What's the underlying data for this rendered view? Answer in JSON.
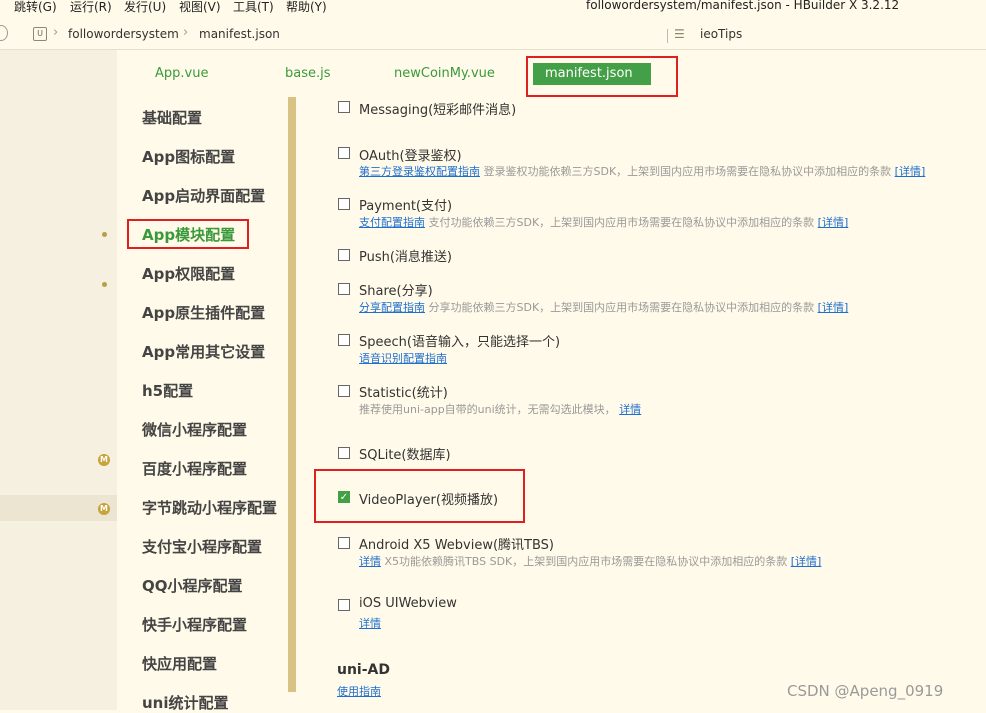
{
  "menubar": {
    "items": [
      "跳转(G)",
      "运行(R)",
      "发行(U)",
      "视图(V)",
      "工具(T)",
      "帮助(Y)"
    ],
    "window_title": "followordersystem/manifest.json - HBuilder X 3.2.12"
  },
  "breadcrumb": {
    "project": "followordersystem",
    "file": "manifest.json",
    "outline": "ieoTips"
  },
  "tabs": [
    "App.vue",
    "base.js",
    "newCoinMy.vue",
    "manifest.json"
  ],
  "settings_nav": [
    "基础配置",
    "App图标配置",
    "App启动界面配置",
    "App模块配置",
    "App权限配置",
    "App原生插件配置",
    "App常用其它设置",
    "h5配置",
    "微信小程序配置",
    "百度小程序配置",
    "字节跳动小程序配置",
    "支付宝小程序配置",
    "QQ小程序配置",
    "快手小程序配置",
    "快应用配置",
    "uni统计配置"
  ],
  "modules": [
    {
      "label": "Messaging(短彩邮件消息)",
      "checked": false
    },
    {
      "label": "OAuth(登录鉴权)",
      "checked": false,
      "link": "第三方登录鉴权配置指南",
      "note": "登录鉴权功能依赖三方SDK，上架到国内应用市场需要在隐私协议中添加相应的条款",
      "detail": "[详情]"
    },
    {
      "label": "Payment(支付)",
      "checked": false,
      "link": "支付配置指南",
      "note": "支付功能依赖三方SDK，上架到国内应用市场需要在隐私协议中添加相应的条款",
      "detail": "[详情]"
    },
    {
      "label": "Push(消息推送)",
      "checked": false
    },
    {
      "label": "Share(分享)",
      "checked": false,
      "link": "分享配置指南",
      "note": "分享功能依赖三方SDK，上架到国内应用市场需要在隐私协议中添加相应的条款",
      "detail": "[详情]"
    },
    {
      "label": "Speech(语音输入，只能选择一个)",
      "checked": false,
      "link": "语音识别配置指南"
    },
    {
      "label": "Statistic(统计)",
      "checked": false,
      "note": "推荐使用uni-app自带的uni统计，无需勾选此模块，",
      "detail": "详情"
    },
    {
      "label": "SQLite(数据库)",
      "checked": false
    },
    {
      "label": "VideoPlayer(视频播放)",
      "checked": true
    },
    {
      "label": "Android X5 Webview(腾讯TBS)",
      "checked": false,
      "link": "详情",
      "note": "X5功能依赖腾讯TBS SDK，上架到国内应用市场需要在隐私协议中添加相应的条款",
      "detail": "[详情]"
    },
    {
      "label": "iOS UIWebview",
      "checked": false,
      "link": "详情"
    }
  ],
  "uni_ad": {
    "title": "uni-AD",
    "link": "使用指南"
  },
  "watermark": "CSDN @Apeng_0919",
  "colors": {
    "accent": "#43a047",
    "highlight_box": "#e02020",
    "background": "#fffae9"
  }
}
